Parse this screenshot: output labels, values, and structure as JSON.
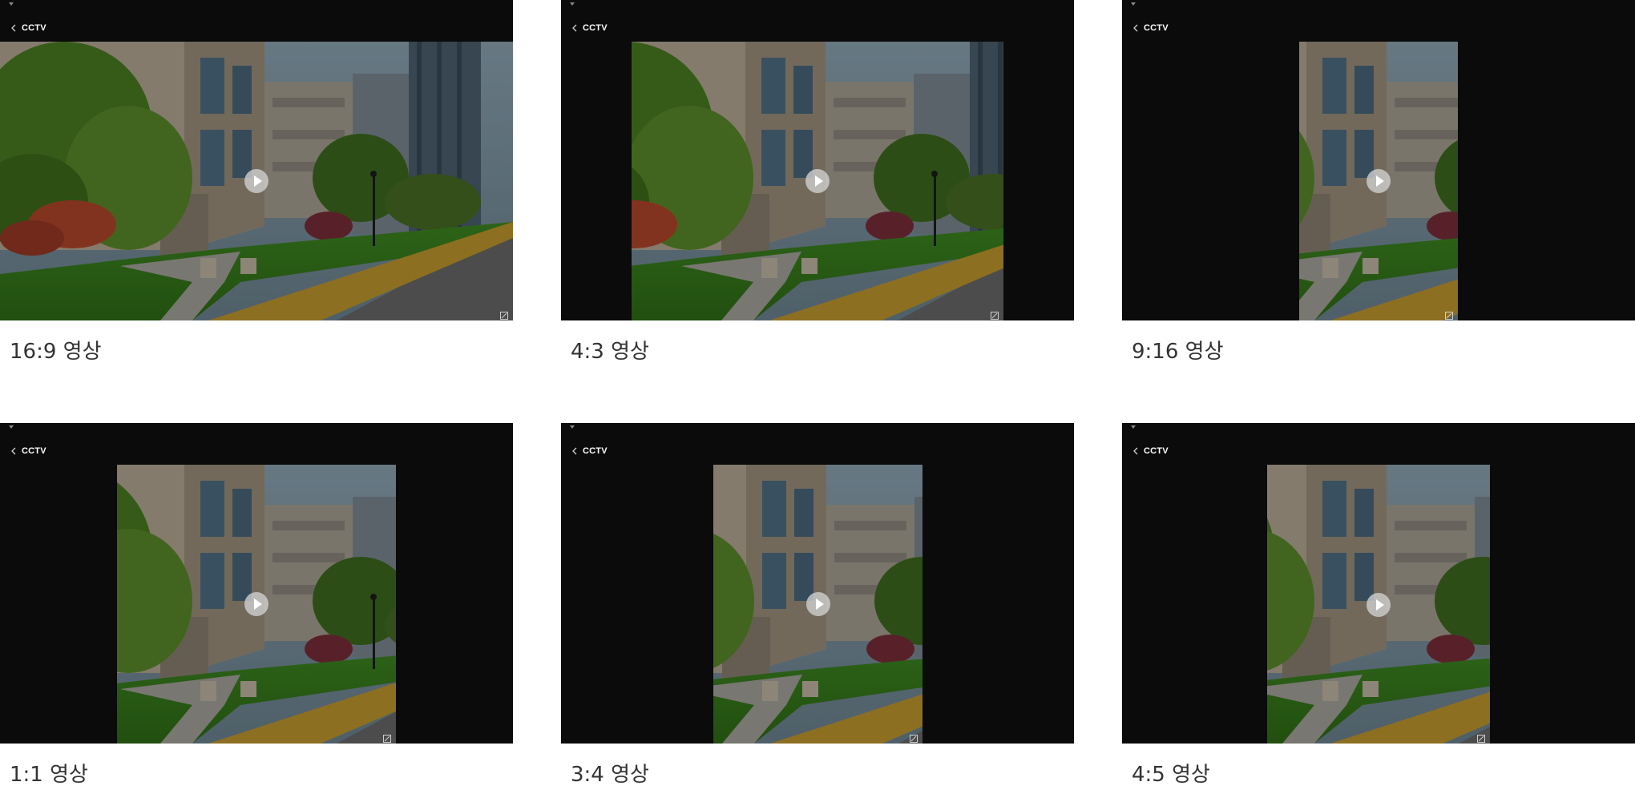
{
  "cards": [
    {
      "header_title": "CCTV",
      "caption": "16:9 영상",
      "aspect": "16:9"
    },
    {
      "header_title": "CCTV",
      "caption": "4:3 영상",
      "aspect": "4:3"
    },
    {
      "header_title": "CCTV",
      "caption": "9:16 영상",
      "aspect": "9:16"
    },
    {
      "header_title": "CCTV",
      "caption": "1:1 영상",
      "aspect": "1:1"
    },
    {
      "header_title": "CCTV",
      "caption": "3:4 영상",
      "aspect": "3:4"
    },
    {
      "header_title": "CCTV",
      "caption": "4:5 영상",
      "aspect": "4:5"
    }
  ],
  "icons": {
    "back": "chevron-left-icon",
    "play": "play-icon",
    "expand": "expand-icon",
    "handle": "caret-down-icon"
  },
  "colors": {
    "player_bg": "#0b0b0b",
    "caption_text": "#333333",
    "header_text": "#ffffff"
  }
}
